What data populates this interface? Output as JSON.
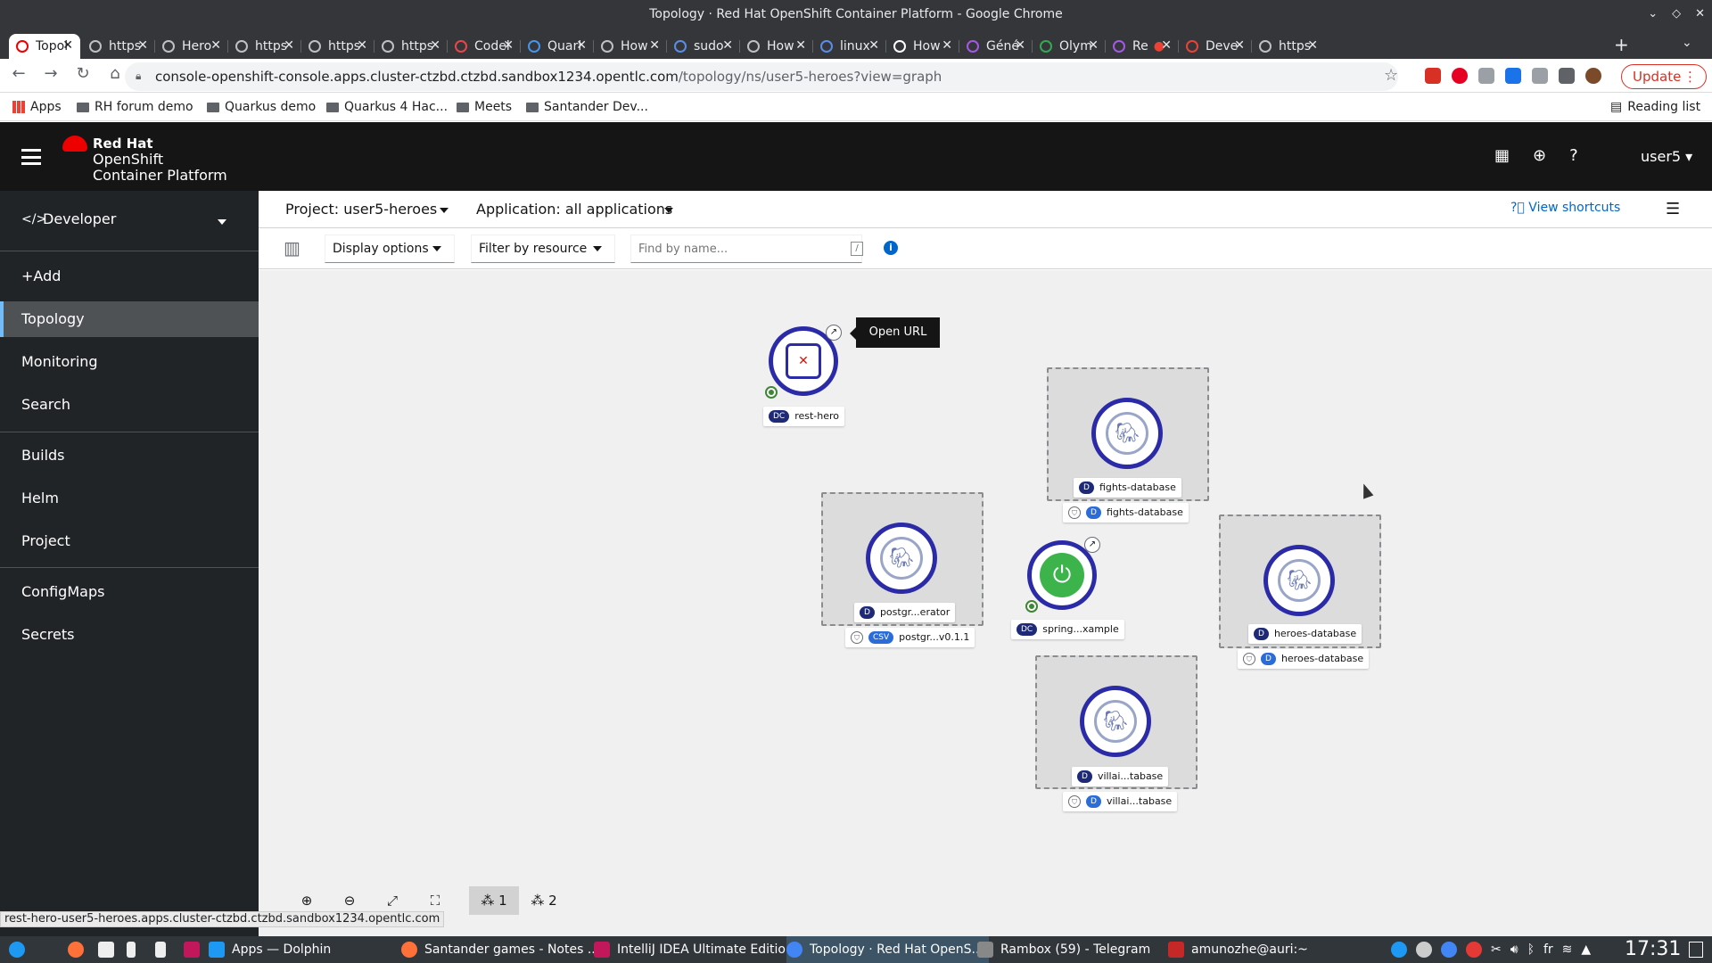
{
  "window": {
    "title": "Topology · Red Hat OpenShift Container Platform - Google Chrome"
  },
  "tabs": [
    {
      "label": "Topol",
      "active": true
    },
    {
      "label": "https"
    },
    {
      "label": "Hero"
    },
    {
      "label": "https"
    },
    {
      "label": "https"
    },
    {
      "label": "https"
    },
    {
      "label": "Codel"
    },
    {
      "label": "Quarl"
    },
    {
      "label": "How"
    },
    {
      "label": "sudo"
    },
    {
      "label": "How"
    },
    {
      "label": "linux"
    },
    {
      "label": "How"
    },
    {
      "label": "Géné"
    },
    {
      "label": "Olym"
    },
    {
      "label": "Re"
    },
    {
      "label": "Deve"
    },
    {
      "label": "https"
    }
  ],
  "address": {
    "host": "console-openshift-console.apps.cluster-ctzbd.ctzbd.sandbox1234.opentlc.com",
    "path": "/topology/ns/user5-heroes?view=graph"
  },
  "update_label": "Update",
  "bookmarks": [
    {
      "label": "Apps"
    },
    {
      "label": "RH forum demo"
    },
    {
      "label": "Quarkus demo"
    },
    {
      "label": "Quarkus 4 Hac..."
    },
    {
      "label": "Meets"
    },
    {
      "label": "Santander Dev..."
    }
  ],
  "reading_list": "Reading list",
  "masthead": {
    "brand_line1": "Red Hat",
    "brand_line2": "OpenShift",
    "brand_line3": "Container Platform",
    "user": "user5"
  },
  "sidebar": {
    "perspective": "Developer",
    "items": [
      "+Add",
      "Topology",
      "Monitoring",
      "Search",
      "Builds",
      "Helm",
      "Project",
      "ConfigMaps",
      "Secrets"
    ],
    "active": "Topology"
  },
  "context": {
    "project": "Project: user5-heroes",
    "application": "Application: all applications",
    "shortcuts": "View shortcuts"
  },
  "filters": {
    "display_options": "Display options",
    "filter_by_resource": "Filter by resource",
    "find_placeholder": "Find by name...",
    "find_shortcut": "/"
  },
  "nodes": {
    "rest_hero": {
      "badge": "DC",
      "name": "rest-hero",
      "tooltip": "Open URL"
    },
    "fights_db": {
      "badge": "D",
      "name": "fights-database",
      "op_name": "fights-database"
    },
    "postgres_op": {
      "badge": "D",
      "name": "postgr...erator",
      "csv_badge": "CSV",
      "csv_name": "postgr...v0.1.1"
    },
    "spring": {
      "badge": "DC",
      "name": "spring...xample"
    },
    "heroes_db": {
      "badge": "D",
      "name": "heroes-database",
      "op_name": "heroes-database"
    },
    "villains_db": {
      "badge": "D",
      "name": "villai...tabase",
      "op_name": "villai...tabase"
    }
  },
  "zoom_controls": {
    "layout1": "1",
    "layout2": "2"
  },
  "status_url": "rest-hero-user5-heroes.apps.cluster-ctzbd.ctzbd.sandbox1234.opentlc.com",
  "taskbar": {
    "items": [
      "Apps — Dolphin",
      "Santander games - Notes ...",
      "IntelliJ IDEA Ultimate Edition",
      "Topology · Red Hat OpenS...",
      "Rambox (59) - Telegram",
      "amunozhe@auri:~"
    ],
    "lang": "fr",
    "clock": "17:31"
  },
  "colors": {
    "accent": "#2b2ba8",
    "masthead": "#151515",
    "sidebar": "#212427",
    "spring": "#3cb44b",
    "update": "#d93025"
  }
}
